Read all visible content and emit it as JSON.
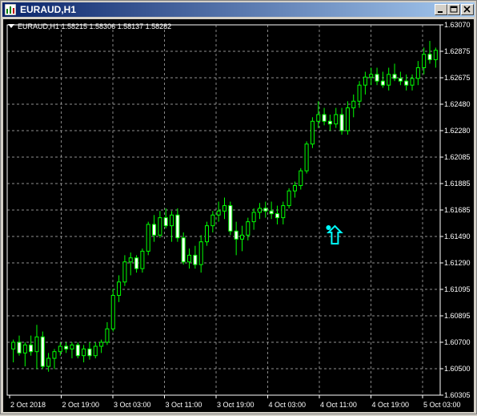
{
  "window": {
    "title": "EURAUD,H1"
  },
  "chart_info": {
    "label": "EURAUD,H1  1.58215 1.58306 1.58137 1.58282"
  },
  "colors": {
    "background": "#000000",
    "candle": "#00ff00",
    "grid": "#c0c0c0",
    "axis_text": "#ffffff",
    "signal": "#00ffff"
  },
  "chart_data": {
    "type": "candlestick",
    "price_ticks": [
      "1.63070",
      "1.62875",
      "1.62675",
      "1.62480",
      "1.62280",
      "1.62085",
      "1.61885",
      "1.61685",
      "1.61490",
      "1.61290",
      "1.61095",
      "1.60895",
      "1.60700",
      "1.60500",
      "1.60305"
    ],
    "ylim": [
      1.60305,
      1.6307
    ],
    "time_ticks": [
      "2 Oct 2018",
      "2 Oct 19:00",
      "3 Oct 03:00",
      "3 Oct 11:00",
      "3 Oct 19:00",
      "4 Oct 03:00",
      "4 Oct 11:00",
      "4 Oct 19:00",
      "5 Oct 03:00"
    ],
    "grid": true,
    "signal_arrow": {
      "type": "buy",
      "candle_index": 54,
      "price": 1.6152
    },
    "candles": [
      [
        1.6065,
        1.6072,
        1.6055,
        1.607
      ],
      [
        1.607,
        1.6075,
        1.606,
        1.6062
      ],
      [
        1.6062,
        1.607,
        1.6052,
        1.6068
      ],
      [
        1.6068,
        1.6075,
        1.606,
        1.6063
      ],
      [
        1.6063,
        1.6083,
        1.605,
        1.6074
      ],
      [
        1.6074,
        1.6078,
        1.605,
        1.6052
      ],
      [
        1.6052,
        1.6062,
        1.6048,
        1.6058
      ],
      [
        1.6058,
        1.6065,
        1.605,
        1.6063
      ],
      [
        1.6063,
        1.607,
        1.606,
        1.6067
      ],
      [
        1.6067,
        1.607,
        1.6062,
        1.6065
      ],
      [
        1.6065,
        1.607,
        1.6058,
        1.6068
      ],
      [
        1.6068,
        1.607,
        1.6058,
        1.606
      ],
      [
        1.606,
        1.6068,
        1.6055,
        1.6065
      ],
      [
        1.6065,
        1.607,
        1.6057,
        1.606
      ],
      [
        1.606,
        1.607,
        1.6058,
        1.6067
      ],
      [
        1.6067,
        1.6072,
        1.6062,
        1.607
      ],
      [
        1.607,
        1.6085,
        1.6068,
        1.608
      ],
      [
        1.608,
        1.611,
        1.6078,
        1.6105
      ],
      [
        1.6105,
        1.612,
        1.61,
        1.6115
      ],
      [
        1.6115,
        1.6135,
        1.6112,
        1.613
      ],
      [
        1.613,
        1.6137,
        1.612,
        1.6133
      ],
      [
        1.6133,
        1.6135,
        1.6122,
        1.6125
      ],
      [
        1.6125,
        1.614,
        1.6122,
        1.6138
      ],
      [
        1.6138,
        1.616,
        1.6135,
        1.6158
      ],
      [
        1.6158,
        1.6165,
        1.6145,
        1.615
      ],
      [
        1.615,
        1.6168,
        1.6148,
        1.6163
      ],
      [
        1.6163,
        1.617,
        1.6155,
        1.6157
      ],
      [
        1.6157,
        1.6168,
        1.6145,
        1.6165
      ],
      [
        1.6165,
        1.617,
        1.6145,
        1.6148
      ],
      [
        1.6148,
        1.6152,
        1.6128,
        1.613
      ],
      [
        1.613,
        1.614,
        1.6125,
        1.6135
      ],
      [
        1.6135,
        1.6142,
        1.6125,
        1.6128
      ],
      [
        1.6128,
        1.615,
        1.6122,
        1.6145
      ],
      [
        1.6145,
        1.616,
        1.6142,
        1.6157
      ],
      [
        1.6157,
        1.6168,
        1.6152,
        1.6165
      ],
      [
        1.6165,
        1.6175,
        1.616,
        1.6168
      ],
      [
        1.6168,
        1.6178,
        1.6162,
        1.6172
      ],
      [
        1.6172,
        1.6175,
        1.615,
        1.6153
      ],
      [
        1.6153,
        1.616,
        1.6135,
        1.6147
      ],
      [
        1.6147,
        1.6157,
        1.6138,
        1.615
      ],
      [
        1.615,
        1.6163,
        1.6146,
        1.616
      ],
      [
        1.616,
        1.617,
        1.6154,
        1.6167
      ],
      [
        1.6167,
        1.6174,
        1.6162,
        1.617
      ],
      [
        1.617,
        1.6175,
        1.6163,
        1.6168
      ],
      [
        1.6168,
        1.6175,
        1.6162,
        1.6166
      ],
      [
        1.6166,
        1.6172,
        1.6158,
        1.6163
      ],
      [
        1.6163,
        1.6175,
        1.6158,
        1.6172
      ],
      [
        1.6172,
        1.6185,
        1.617,
        1.6183
      ],
      [
        1.6183,
        1.619,
        1.6178,
        1.6187
      ],
      [
        1.6187,
        1.62,
        1.6184,
        1.6198
      ],
      [
        1.6198,
        1.622,
        1.6196,
        1.6218
      ],
      [
        1.6218,
        1.6238,
        1.6215,
        1.6235
      ],
      [
        1.6235,
        1.625,
        1.623,
        1.624
      ],
      [
        1.624,
        1.6245,
        1.6232,
        1.6235
      ],
      [
        1.6235,
        1.624,
        1.6228,
        1.6233
      ],
      [
        1.6233,
        1.6245,
        1.623,
        1.624
      ],
      [
        1.624,
        1.6245,
        1.6225,
        1.6228
      ],
      [
        1.6228,
        1.625,
        1.6225,
        1.6245
      ],
      [
        1.6245,
        1.6255,
        1.6238,
        1.625
      ],
      [
        1.625,
        1.6265,
        1.6245,
        1.6262
      ],
      [
        1.6262,
        1.6272,
        1.6255,
        1.6268
      ],
      [
        1.6268,
        1.6275,
        1.6262,
        1.627
      ],
      [
        1.627,
        1.6275,
        1.6262,
        1.6265
      ],
      [
        1.6265,
        1.6272,
        1.626,
        1.6262
      ],
      [
        1.6262,
        1.6275,
        1.6258,
        1.627
      ],
      [
        1.627,
        1.6278,
        1.6265,
        1.6267
      ],
      [
        1.6267,
        1.6272,
        1.6262,
        1.6265
      ],
      [
        1.6265,
        1.627,
        1.6258,
        1.6262
      ],
      [
        1.6262,
        1.627,
        1.6258,
        1.6267
      ],
      [
        1.6267,
        1.628,
        1.6262,
        1.6275
      ],
      [
        1.6275,
        1.629,
        1.627,
        1.6285
      ],
      [
        1.6285,
        1.6295,
        1.6278,
        1.6281
      ],
      [
        1.6281,
        1.629,
        1.6275,
        1.6288
      ]
    ]
  }
}
